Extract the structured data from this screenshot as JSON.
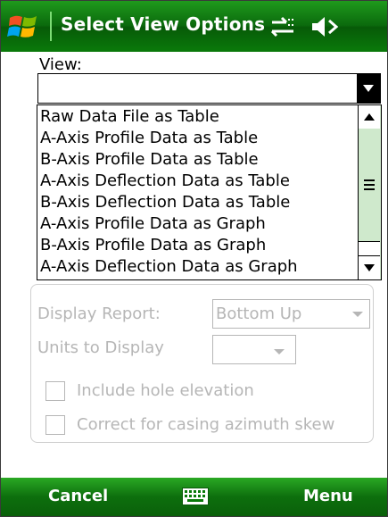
{
  "title_bar": {
    "title": "Select View Options",
    "icons": [
      "windows-start-icon",
      "connectivity-icon",
      "volume-icon"
    ]
  },
  "view": {
    "label": "View:",
    "selected_value": "",
    "options": [
      "Raw Data File as Table",
      "A-Axis Profile Data as Table",
      "B-Axis Profile Data as Table",
      "A-Axis Deflection Data as Table",
      "B-Axis Deflection Data as Table",
      "A-Axis Profile Data as Graph",
      "B-Axis Profile Data as Graph",
      "A-Axis Deflection Data as Graph"
    ]
  },
  "options_group": {
    "display_report_label": "Display Report:",
    "display_report_value": "Bottom Up",
    "units_label": "Units to Display",
    "units_value": "",
    "include_hole_elevation_label": "Include hole elevation",
    "include_hole_elevation_checked": false,
    "correct_azimuth_label": "Correct for casing azimuth skew",
    "correct_azimuth_checked": false
  },
  "soft_keys": {
    "left": "Cancel",
    "right": "Menu",
    "center_icon": "keyboard-icon"
  },
  "colors": {
    "title_bar": "#0b6a0d",
    "soft_key_bar": "#0d6f0d",
    "scrollbar": "#d3ecd0",
    "disabled_text": "#b6b6b6"
  }
}
